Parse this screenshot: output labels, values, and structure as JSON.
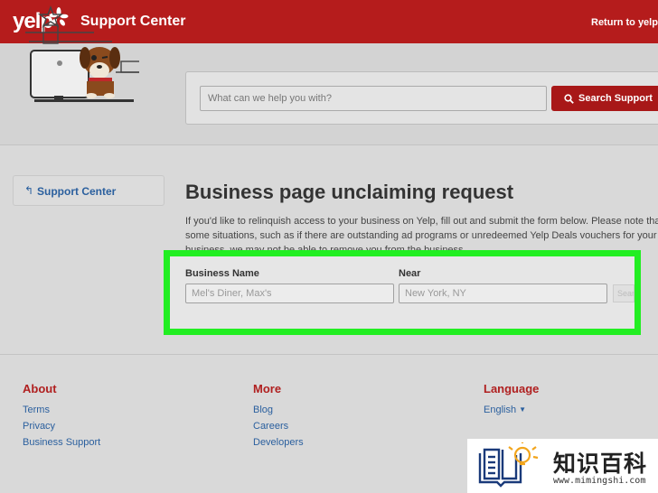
{
  "header": {
    "logo": "yelp",
    "title": "Support Center",
    "return_link": "Return to yelp.c"
  },
  "search": {
    "placeholder": "What can we help you with?",
    "button_label": "Search Support"
  },
  "sidebar": {
    "support_link": "Support Center"
  },
  "main": {
    "title": "Business page unclaiming request",
    "intro_lines": [
      "If you'd like to relinquish access to your business on Yelp, fill out and submit the form below. Please note tha",
      "some situations, such as if there are outstanding ad programs or unredeemed Yelp Deals vouchers for your",
      "business, we may not be able to remove you from the business."
    ]
  },
  "form": {
    "business_label": "Business Name",
    "business_placeholder": "Mel's Diner, Max's",
    "near_label": "Near",
    "near_placeholder": "New York, NY",
    "search_button": "Search"
  },
  "footer": {
    "about": {
      "heading": "About",
      "links": [
        "Terms",
        "Privacy",
        "Business Support"
      ]
    },
    "more": {
      "heading": "More",
      "links": [
        "Blog",
        "Careers",
        "Developers"
      ]
    },
    "language": {
      "heading": "Language",
      "selected": "English"
    }
  },
  "watermark": {
    "text": "知识百科",
    "url": "www.mimingshi.com"
  },
  "colors": {
    "brand_red": "#b51c1c",
    "link_blue": "#2a5f9e",
    "highlight_green": "#22ee22"
  },
  "icons": {
    "search": "search-icon",
    "back": "back-arrow-icon",
    "caret": "caret-down-icon"
  }
}
